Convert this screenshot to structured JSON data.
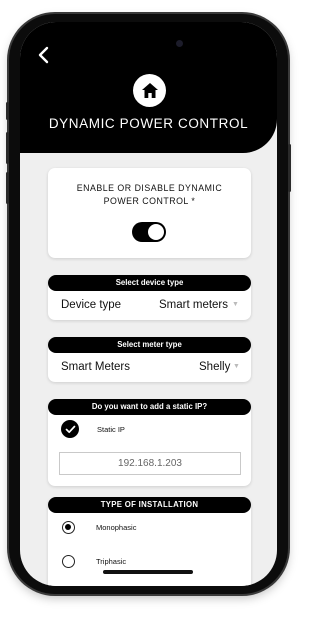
{
  "header": {
    "title": "DYNAMIC POWER CONTROL"
  },
  "power_control": {
    "label": "ENABLE OR DISABLE DYNAMIC POWER CONTROL *",
    "enabled": true
  },
  "device_type": {
    "section_title": "Select device type",
    "label": "Device type",
    "value": "Smart meters"
  },
  "meter_type": {
    "section_title": "Select meter type",
    "label": "Smart Meters",
    "value": "Shelly"
  },
  "static_ip": {
    "section_title": "Do you want to add a static IP?",
    "option_label": "Static IP",
    "checked": true,
    "ip_value": "192.168.1.203"
  },
  "installation": {
    "section_title": "TYPE OF INSTALLATION",
    "options": [
      {
        "label": "Monophasic",
        "selected": true
      },
      {
        "label": "Triphasic",
        "selected": false
      }
    ]
  }
}
